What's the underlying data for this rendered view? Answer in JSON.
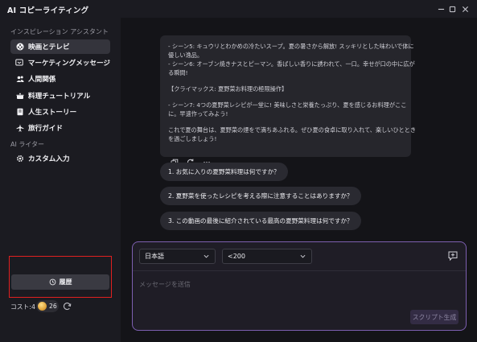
{
  "window": {
    "title": "AI コピーライティング",
    "controls": [
      "minimize-icon",
      "maximize-icon",
      "close-icon"
    ]
  },
  "sidebar": {
    "section_inspiration": "インスピレーション アシスタント",
    "items": [
      {
        "label": "映画とテレビ",
        "icon": "film-icon",
        "active": true
      },
      {
        "label": "マーケティングメッセージ",
        "icon": "megaphone-icon",
        "active": false
      },
      {
        "label": "人間関係",
        "icon": "people-icon",
        "active": false
      },
      {
        "label": "料理チュートリアル",
        "icon": "cooking-icon",
        "active": false
      },
      {
        "label": "人生ストーリー",
        "icon": "book-icon",
        "active": false
      },
      {
        "label": "旅行ガイド",
        "icon": "airplane-icon",
        "active": false
      }
    ],
    "section_writer": "AI ライター",
    "writer_items": [
      {
        "label": "カスタム入力",
        "icon": "gear-icon"
      }
    ],
    "history_label": "履歴",
    "cost_label": "コスト:4",
    "coin_count": "26"
  },
  "chat": {
    "message_lines": [
      "- シーン5: キュウリとわかめの冷たいスープ。夏の暑さから解放! スッキリとした味わいで体に",
      "優しい逸品。",
      "- シーン6: オーブン焼きナスとピーマン。香ばしい香りに誘われて、一口。幸せが口の中に広が",
      "る瞬間!",
      "",
      "【クライマックス: 夏野菜お料理の極限操作】",
      "",
      "- シーン7: 4つの夏野菜レシピが一堂に! 美味しさと栄養たっぷり、夏を感じるお料理がここ",
      "に。早速作ってみよう!",
      "",
      "これで夏の舞台は、夏野菜の煙をで満ちあふれる。ぜひ夏の食卓に取り入れて、楽しいひととき",
      "を過ごしましょう!"
    ],
    "actions": [
      "copy-icon",
      "regenerate-icon",
      "more-icon"
    ],
    "suggestions": [
      "1. お気に入りの夏野菜料理は何ですか？",
      "2. 夏野菜を使ったレシピを考える際に注意することはありますか？",
      "3. この動画の最後に紹介されている最高の夏野菜料理は何ですか？"
    ]
  },
  "composer": {
    "language": "日本語",
    "length": "<200",
    "placeholder": "メッセージを送信",
    "submit_label": "スクリプト生成"
  },
  "colors": {
    "accent_border": "#7d5fb0",
    "highlight_frame": "#e02020",
    "sidebar_bg": "#1b1b21",
    "main_bg": "#141418"
  }
}
